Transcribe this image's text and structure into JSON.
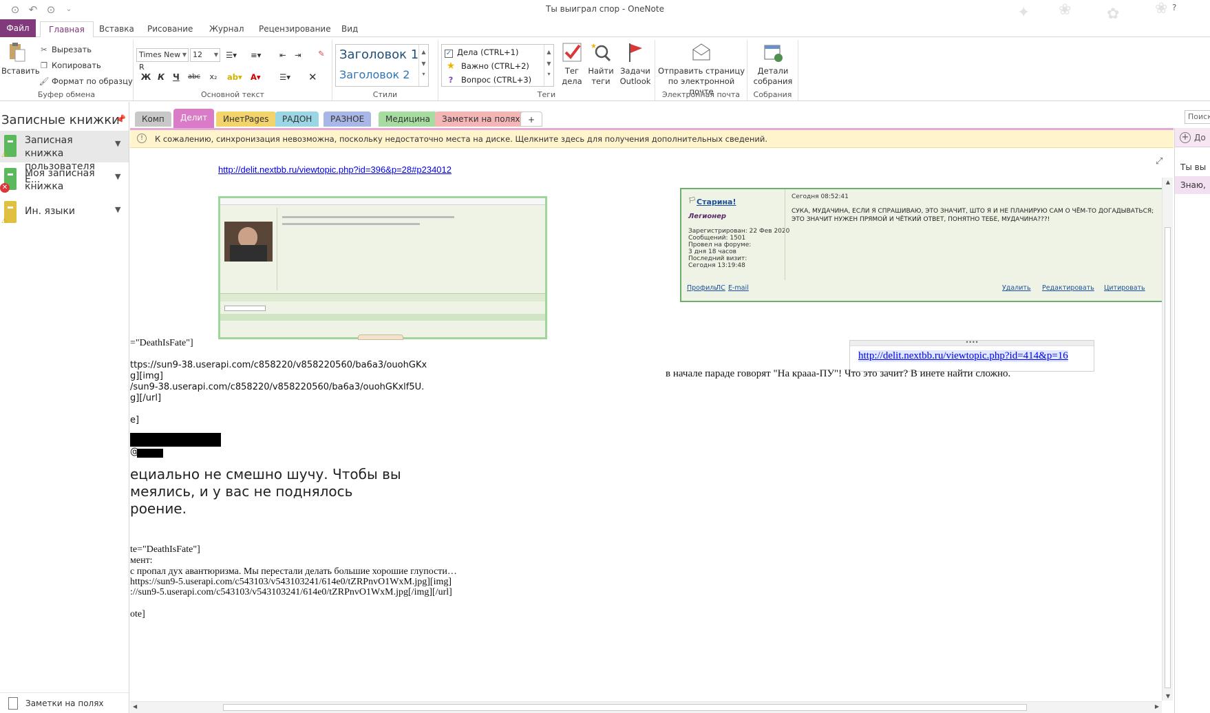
{
  "window": {
    "title": "Ты выиграл спор - OneNote",
    "help": "?"
  },
  "ribbon_tabs": [
    "Файл",
    "Главная",
    "Вставка",
    "Рисование",
    "Журнал",
    "Рецензирование",
    "Вид"
  ],
  "clipboard": {
    "paste": "Вставить",
    "cut": "Вырезать",
    "copy": "Копировать",
    "format_painter": "Формат по образцу",
    "label": "Буфер обмена"
  },
  "basic_text": {
    "font_name": "Times New R",
    "font_size": "12",
    "bold": "Ж",
    "italic": "К",
    "underline": "Ч",
    "strike": "abc",
    "subscript": "x₂",
    "label": "Основной текст"
  },
  "styles": {
    "heading1": "Заголовок 1",
    "heading2": "Заголовок 2",
    "label": "Стили"
  },
  "tags": {
    "items": [
      "Дела (CTRL+1)",
      "Важно (CTRL+2)",
      "Вопрос (CTRL+3)"
    ],
    "todo_tag": "Тег дела",
    "find_tags": "Найти теги",
    "outlook_tasks": "Задачи Outlook",
    "label": "Теги"
  },
  "email": {
    "send": "Отправить страницу по электронной почте",
    "label": "Электронная почта"
  },
  "meetings": {
    "details": "Детали собрания",
    "label": "Собрания"
  },
  "nav": {
    "title": "Записные книжки",
    "notebooks": [
      {
        "name": "Записная книжка пользователя Е...",
        "color": "#5cb85c"
      },
      {
        "name": "Моя записная книжка",
        "color": "#5cb85c"
      },
      {
        "name": "Ин. языки",
        "color": "#e0c040"
      }
    ],
    "footer": "Заметки на полях"
  },
  "sections": [
    {
      "label": "Комп",
      "color": "#c8c8c8"
    },
    {
      "label": "Делит",
      "color": "#d97bc7"
    },
    {
      "label": "ИнетPages",
      "color": "#f3d36b"
    },
    {
      "label": "РАДОН",
      "color": "#9ad6e3"
    },
    {
      "label": "РАЗНОЕ",
      "color": "#a9b7e6"
    },
    {
      "label": "Медицина",
      "color": "#a7dca0"
    },
    {
      "label": "Заметки на полях",
      "color": "#f4b5b5"
    },
    {
      "label": "+",
      "color": "#ffffff"
    }
  ],
  "search_placeholder": "Поиск",
  "infobar": "К сожалению, синхронизация невозможна, поскольку недостаточно места на диске. Щелкните здесь для получения дополнительных сведений.",
  "page": {
    "link1": "http://delit.nextbb.ru/viewtopic.php?id=396&p=28#p234012",
    "link2": "http://delit.nextbb.ru/viewtopic.php?id=414&p=16",
    "caption": "в начале параде говорят \"На крааа-ПУ\"! Что это зачит? В инете найти сложно.",
    "lines": [
      "=\"DeathIsFate\"]",
      "ttps://sun9-38.userapi.com/c858220/v858220560/ba6a3/ouohGKx",
      "g][img]",
      "/sun9-38.userapi.com/c858220/v858220560/ba6a3/ouohGKxlf5U.",
      "g][/url]",
      "e]",
      "@"
    ],
    "big_text": [
      "ециально не смешно шучу. Чтобы вы",
      "меялись, и у вас не поднялось",
      "роение."
    ],
    "lines2": [
      "te=\"DeathIsFate\"]",
      "мент:",
      "с пропал дух авантюризма. Мы перестали делать большие хорошие глупости…",
      "https://sun9-5.userapi.com/c543103/v543103241/614e0/tZRPnvO1WxM.jpg][img]",
      "://sun9-5.userapi.com/c543103/v543103241/614e0/tZRPnvO1WxM.jpg[/img][/url]",
      "ote]"
    ]
  },
  "forum_post": {
    "user": "Старина!",
    "role": "Легионер",
    "meta": [
      "Зарегистрирован: 22 Фев 2020",
      "Сообщений: 1501",
      "Провел на форуме:",
      "3 дня 18 часов",
      "Последний визит:",
      "Сегодня 13:19:48"
    ],
    "date": "Сегодня 08:52:41",
    "text": "СУКА, МУДАЧИНА, ЕСЛИ Я СПРАШИВАЮ, ЭТО ЗНАЧИТ, ШТО Я И НЕ ПЛАНИРУЮ САМ О ЧЁМ-ТО ДОГАДЫВАТЬСЯ; ЭТО ЗНАЧИТ НУЖЕН ПРЯМОЙ И ЧЁТКИЙ ОТВЕТ, ПОНЯТНО ТЕБЕ, МУДАЧИНА???!",
    "links_left": [
      "Профиль",
      "ЛС",
      "E-mail"
    ],
    "links_right": [
      "Удалить",
      "Редактировать",
      "Цитировать"
    ]
  },
  "right_panel": {
    "add": "До",
    "pages": [
      "Ты вы",
      "Знаю,"
    ]
  }
}
